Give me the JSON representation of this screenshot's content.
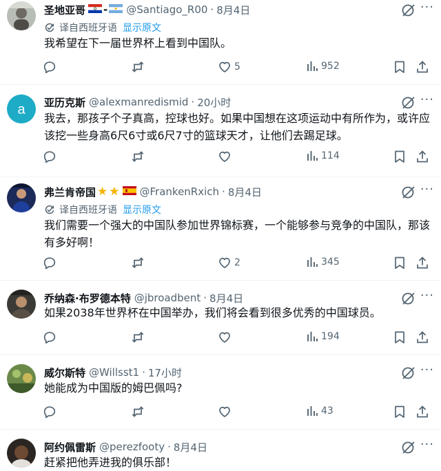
{
  "tweets": [
    {
      "name": "圣地亚哥",
      "handle": "@Santiago_R00",
      "time": "8月4日",
      "translated": true,
      "text": "我希望在下一届世界杯上看到中国队。",
      "replies": "",
      "retweets": "",
      "likes": "5",
      "views": "952"
    },
    {
      "name": "亚历克斯",
      "handle": "@alexmanredismid",
      "time": "20小时",
      "translated": false,
      "text": "我去，那孩子个子真高，控球也好。如果中国想在这项运动中有所作为，或许应该挖一些身高6尺6寸或6尺7寸的篮球天才，让他们去踢足球。",
      "replies": "",
      "retweets": "",
      "likes": "",
      "views": "114"
    },
    {
      "name": "弗兰肯帝国",
      "handle": "@FrankenRxich",
      "time": "8月4日",
      "translated": true,
      "text": "我们需要一个强大的中国队参加世界锦标赛，一个能够参与竞争的中国队，那该有多好啊！",
      "replies": "",
      "retweets": "",
      "likes": "2",
      "views": "345"
    },
    {
      "name": "乔纳森·布罗德本特",
      "handle": "@jbroadbent",
      "time": "8月4日",
      "translated": false,
      "text": "如果2038年世界杯在中国举办，我们将会看到很多优秀的中国球员。",
      "replies": "",
      "retweets": "",
      "likes": "",
      "views": "194"
    },
    {
      "name": "威尔斯特",
      "handle": "@Willsst1",
      "time": "17小时",
      "translated": false,
      "text": "她能成为中国版的姆巴佩吗?",
      "replies": "",
      "retweets": "",
      "likes": "",
      "views": "43"
    },
    {
      "name": "阿约佩雷斯",
      "handle": "@perezfooty",
      "time": "8月4日",
      "translated": false,
      "text": "赶紧把他弄进我的俱乐部！",
      "replies": "",
      "retweets": "",
      "likes": "",
      "views": ""
    }
  ],
  "translate": {
    "label": "译自西班牙语",
    "show_original": "显示原文"
  },
  "separator": "·",
  "avatar2_letter": "a",
  "colors": {
    "text": "#0f1419",
    "secondary": "#536471",
    "link": "#1d9bf0",
    "avatar2": "#1dabc6",
    "star": "#f5b301"
  },
  "icons": [
    "reply-icon",
    "retweet-icon",
    "like-icon",
    "views-icon",
    "bookmark-icon",
    "share-icon",
    "grok-icon",
    "more-icon",
    "translate-icon"
  ]
}
